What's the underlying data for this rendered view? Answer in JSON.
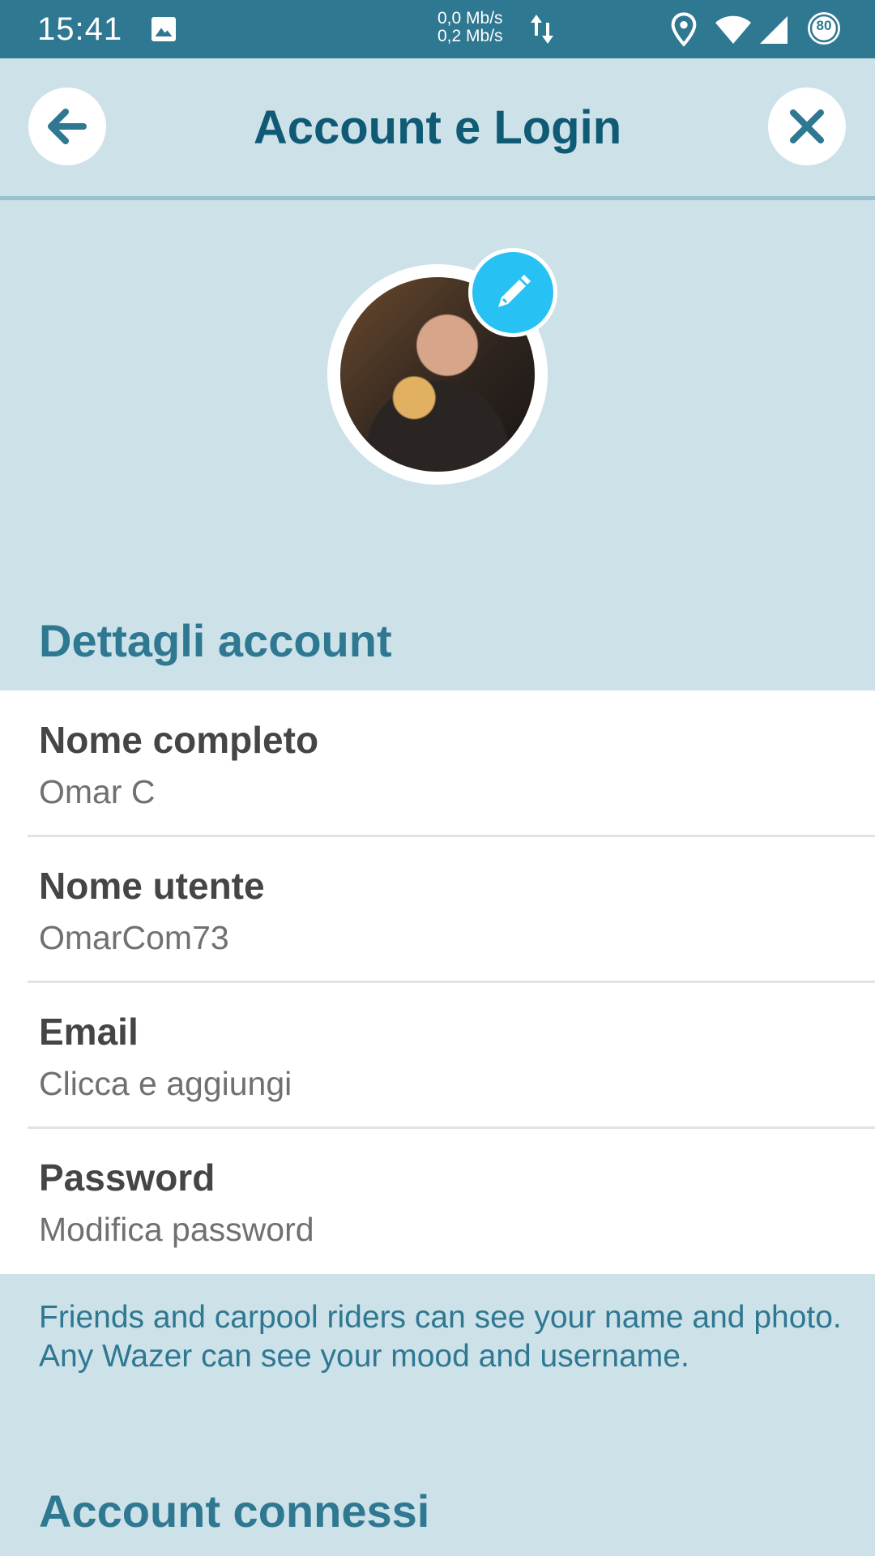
{
  "status_bar": {
    "time": "15:41",
    "net_up": "0,0 Mb/s",
    "net_down": "0,2 Mb/s",
    "battery": "80",
    "icons": [
      "image-icon",
      "data-transfer-icon",
      "location-icon",
      "wifi-icon",
      "signal-icon",
      "battery-icon"
    ]
  },
  "header": {
    "title": "Account e Login",
    "back_icon": "arrow-left-icon",
    "close_icon": "close-icon"
  },
  "profile": {
    "edit_icon": "pencil-icon"
  },
  "account_details": {
    "section_title": "Dettagli account",
    "rows": [
      {
        "label": "Nome completo",
        "value": "Omar C"
      },
      {
        "label": "Nome utente",
        "value": "OmarCom73"
      },
      {
        "label": "Email",
        "value": "Clicca e aggiungi"
      },
      {
        "label": "Password",
        "value": "Modifica password"
      }
    ],
    "note": "Friends and carpool riders can see your name and photo. Any Wazer can see your mood and username."
  },
  "connected_accounts": {
    "section_title": "Account connessi"
  },
  "colors": {
    "accent": "#2f7891",
    "title": "#0f5a75",
    "background": "#cde1e9",
    "edit_badge": "#27c2f3"
  }
}
